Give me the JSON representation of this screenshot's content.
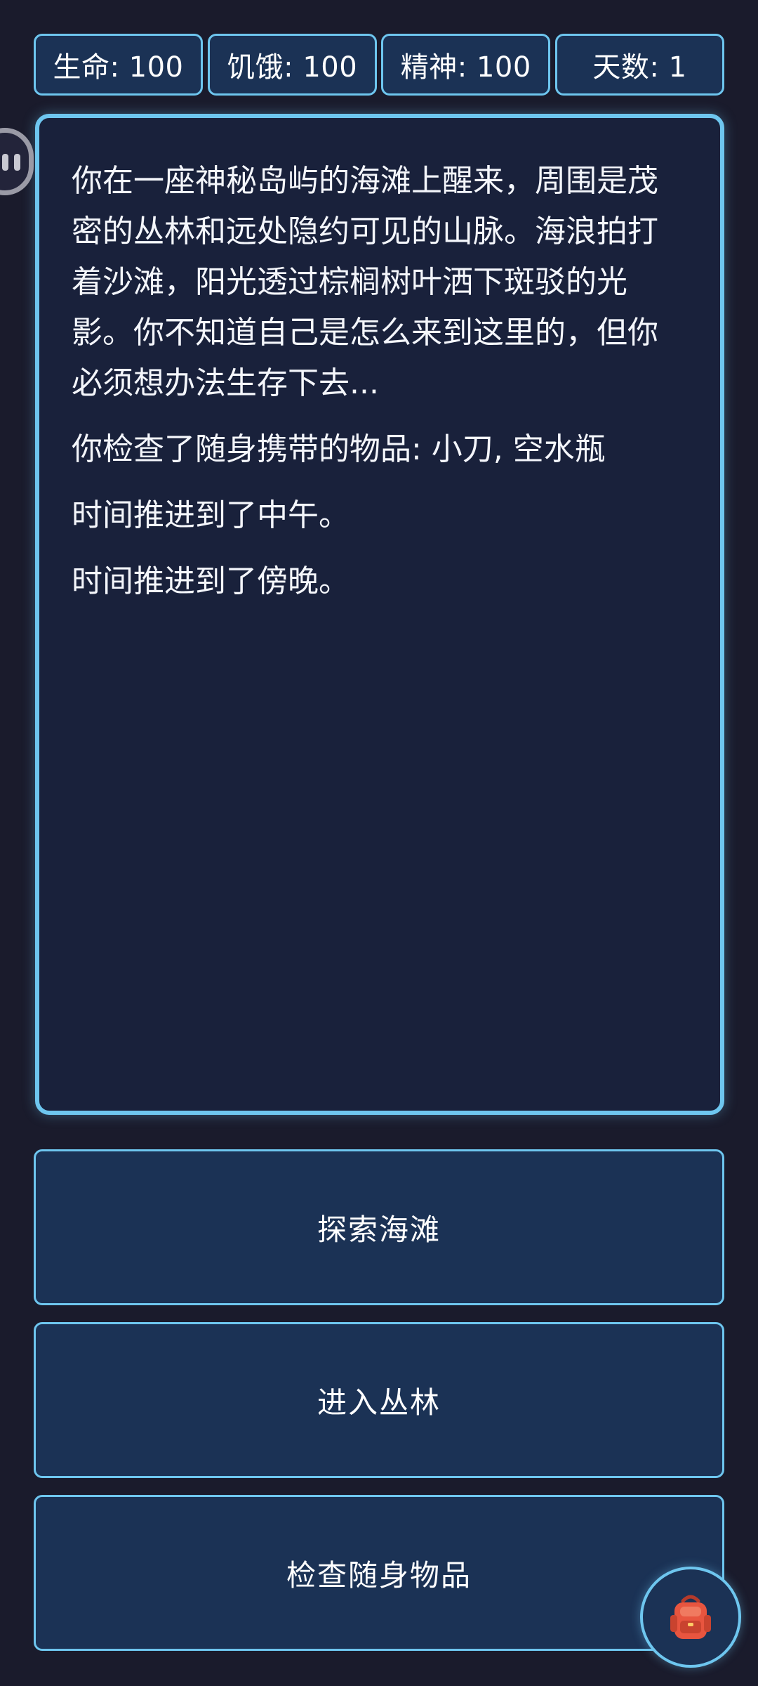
{
  "stats": {
    "health": "生命: 100",
    "hunger": "饥饿: 100",
    "spirit": "精神: 100",
    "day": "天数: 1"
  },
  "story": {
    "paragraphs": [
      "你在一座神秘岛屿的海滩上醒来，周围是茂密的丛林和远处隐约可见的山脉。海浪拍打着沙滩，阳光透过棕榈树叶洒下斑驳的光影。你不知道自己是怎么来到这里的，但你必须想办法生存下去...",
      "你检查了随身携带的物品: 小刀, 空水瓶",
      "时间推进到了中午。",
      "时间推进到了傍晚。"
    ]
  },
  "choices": [
    {
      "label": "探索海滩"
    },
    {
      "label": "进入丛林"
    },
    {
      "label": "检查随身物品"
    }
  ],
  "icons": {
    "side_handle": "floating-handle-icon",
    "backpack": "backpack-icon"
  },
  "colors": {
    "background": "#1a1b2c",
    "panel": "#19213b",
    "button": "#1b3255",
    "accent_border": "#6ec6ef",
    "backpack": "#e8553f"
  }
}
